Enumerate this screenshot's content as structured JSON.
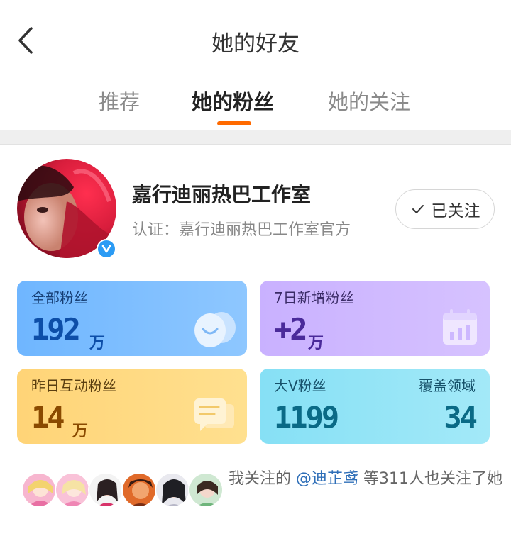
{
  "header": {
    "title": "她的好友"
  },
  "tabs": [
    {
      "label": "推荐"
    },
    {
      "label": "她的粉丝"
    },
    {
      "label": "她的关注"
    }
  ],
  "profile": {
    "name": "嘉行迪丽热巴工作室",
    "certification": "认证：嘉行迪丽热巴工作室官方",
    "follow_label": "已关注"
  },
  "stats": {
    "all_fans": {
      "label": "全部粉丝",
      "value": "192",
      "unit": "万"
    },
    "new_7d": {
      "label": "7日新增粉丝",
      "value": "+2",
      "unit": "万"
    },
    "interactive_yesterday": {
      "label": "昨日互动粉丝",
      "value": "14",
      "unit": "万"
    },
    "big_v": {
      "label": "大V粉丝",
      "value": "1199",
      "label2": "覆盖领域",
      "value2": "34"
    }
  },
  "mutual": {
    "prefix": "我关注的 ",
    "user": "@迪芷鸢",
    "suffix": " 等311人也关注了她"
  },
  "colors": {
    "accent": "#ff6a00",
    "verify": "#2b9bf4",
    "link": "#2f6fb8"
  }
}
